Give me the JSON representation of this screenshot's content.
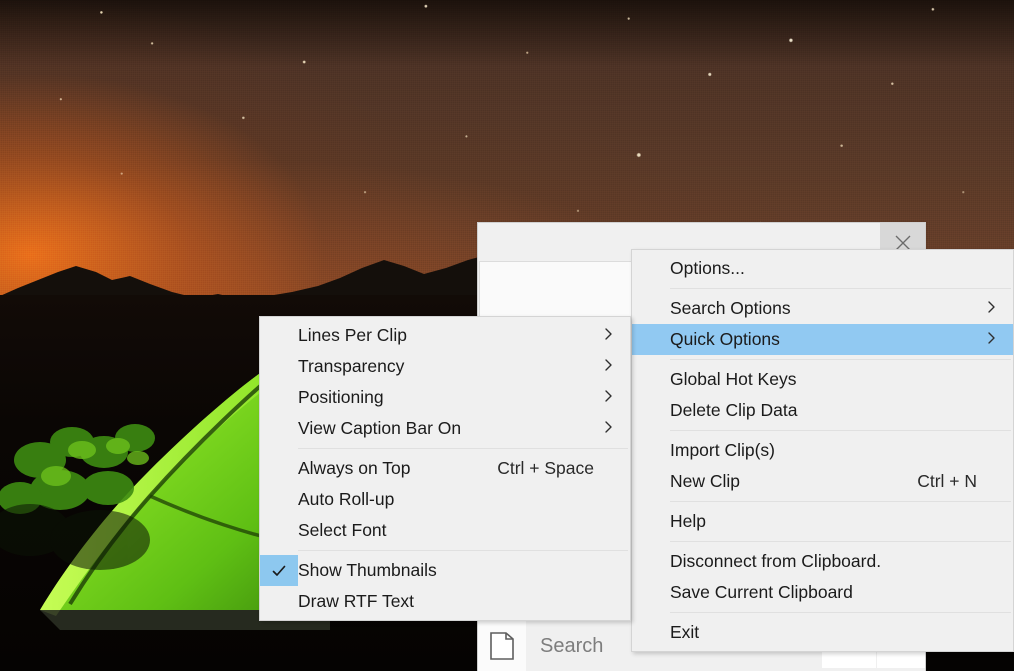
{
  "wallpaper": {
    "description": "night-sky-camping-tent-photo",
    "sky_color": "#7b4526",
    "glow_color": "#ff7819",
    "tent_color": "#7ce22a",
    "ridge_color": "#14100c"
  },
  "app_window": {
    "title": "",
    "close_label": "Close",
    "close_icon": "close-icon",
    "search": {
      "placeholder": "Search",
      "value": "",
      "clip_icon": "clipboard-document-icon"
    },
    "overflow_label": "",
    "overflow_icon": "ellipsis-icon"
  },
  "main_menu": {
    "name": "clipboard-main-context-menu",
    "items": [
      {
        "id": "options",
        "label": "Options...",
        "accel": "",
        "arrow": false,
        "checked": false,
        "highlight": false,
        "sep_after": true
      },
      {
        "id": "search-options",
        "label": "Search Options",
        "accel": "",
        "arrow": true,
        "checked": false,
        "highlight": false,
        "sep_after": false
      },
      {
        "id": "quick-options",
        "label": "Quick Options",
        "accel": "",
        "arrow": true,
        "checked": false,
        "highlight": true,
        "sep_after": true
      },
      {
        "id": "global-hot-keys",
        "label": "Global Hot Keys",
        "accel": "",
        "arrow": false,
        "checked": false,
        "highlight": false,
        "sep_after": false
      },
      {
        "id": "delete-clip-data",
        "label": "Delete Clip Data",
        "accel": "",
        "arrow": false,
        "checked": false,
        "highlight": false,
        "sep_after": true
      },
      {
        "id": "import-clips",
        "label": "Import Clip(s)",
        "accel": "",
        "arrow": false,
        "checked": false,
        "highlight": false,
        "sep_after": false
      },
      {
        "id": "new-clip",
        "label": "New Clip",
        "accel": "Ctrl + N",
        "arrow": false,
        "checked": false,
        "highlight": false,
        "sep_after": true
      },
      {
        "id": "help",
        "label": "Help",
        "accel": "",
        "arrow": false,
        "checked": false,
        "highlight": false,
        "sep_after": true
      },
      {
        "id": "disconnect-clipboard",
        "label": "Disconnect from Clipboard.",
        "accel": "",
        "arrow": false,
        "checked": false,
        "highlight": false,
        "sep_after": false
      },
      {
        "id": "save-current-clipboard",
        "label": "Save Current Clipboard",
        "accel": "",
        "arrow": false,
        "checked": false,
        "highlight": false,
        "sep_after": true
      },
      {
        "id": "exit",
        "label": "Exit",
        "accel": "",
        "arrow": false,
        "checked": false,
        "highlight": false,
        "sep_after": false
      }
    ]
  },
  "quick_options_submenu": {
    "name": "quick-options-submenu",
    "items": [
      {
        "id": "lines-per-clip",
        "label": "Lines Per Clip",
        "accel": "",
        "arrow": true,
        "checked": false,
        "highlight": false,
        "sep_after": false
      },
      {
        "id": "transparency",
        "label": "Transparency",
        "accel": "",
        "arrow": true,
        "checked": false,
        "highlight": false,
        "sep_after": false
      },
      {
        "id": "positioning",
        "label": "Positioning",
        "accel": "",
        "arrow": true,
        "checked": false,
        "highlight": false,
        "sep_after": false
      },
      {
        "id": "view-caption-bar",
        "label": "View Caption Bar On",
        "accel": "",
        "arrow": true,
        "checked": false,
        "highlight": false,
        "sep_after": true
      },
      {
        "id": "always-on-top",
        "label": "Always on Top",
        "accel": "Ctrl + Space",
        "arrow": false,
        "checked": false,
        "highlight": false,
        "sep_after": false
      },
      {
        "id": "auto-roll-up",
        "label": "Auto Roll-up",
        "accel": "",
        "arrow": false,
        "checked": false,
        "highlight": false,
        "sep_after": false
      },
      {
        "id": "select-font",
        "label": "Select Font",
        "accel": "",
        "arrow": false,
        "checked": false,
        "highlight": false,
        "sep_after": true
      },
      {
        "id": "show-thumbnails",
        "label": "Show Thumbnails",
        "accel": "",
        "arrow": false,
        "checked": true,
        "highlight": false,
        "sep_after": false
      },
      {
        "id": "draw-rtf-text",
        "label": "Draw RTF Text",
        "accel": "",
        "arrow": false,
        "checked": false,
        "highlight": false,
        "sep_after": false
      }
    ]
  },
  "colors": {
    "menu_background": "#f0f0f0",
    "menu_highlight": "#91c9f2",
    "check_background": "#8dc8ef",
    "menu_text": "#1b1b1b",
    "separator": "#e0e0e0",
    "window_background": "#f0f0f0",
    "search_placeholder_text": "#7d7d7d"
  }
}
